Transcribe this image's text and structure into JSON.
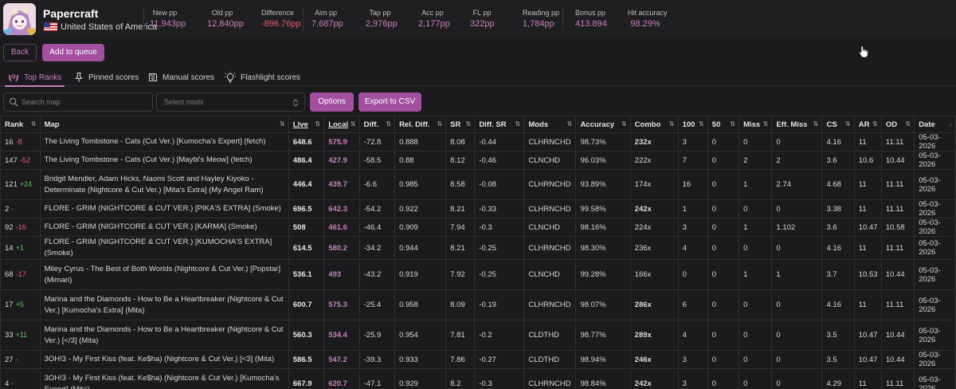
{
  "profile": {
    "username": "Papercraft",
    "country": "United States of America"
  },
  "stats": [
    {
      "label": "New pp",
      "value": "11,943pp"
    },
    {
      "label": "Old pp",
      "value": "12,840pp"
    },
    {
      "label": "Difference",
      "value": "-896.76pp"
    },
    {
      "label": "Aim pp",
      "value": "7,687pp"
    },
    {
      "label": "Tap pp",
      "value": "2,976pp"
    },
    {
      "label": "Acc pp",
      "value": "2,177pp"
    },
    {
      "label": "FL pp",
      "value": "322pp"
    },
    {
      "label": "Reading pp",
      "value": "1,784pp"
    },
    {
      "label": "Bonus pp",
      "value": "413.894"
    },
    {
      "label": "Hit accuracy",
      "value": "98.29%"
    }
  ],
  "colors": {
    "accent": "#a24fa0",
    "accent_text": "#c87fbf",
    "negative": "#e06070",
    "positive": "#5fc25f",
    "combo_highlight": "#8fe04a"
  },
  "actions": {
    "back": "Back",
    "add_to_queue": "Add to queue",
    "options": "Options",
    "export": "Export to CSV"
  },
  "tabs": [
    {
      "label": "Top Ranks",
      "icon": "laurel-icon",
      "active": true
    },
    {
      "label": "Pinned scores",
      "icon": "pin-icon",
      "active": false
    },
    {
      "label": "Manual scores",
      "icon": "save-icon",
      "active": false
    },
    {
      "label": "Flashlight scores",
      "icon": "lightbulb-icon",
      "active": false
    }
  ],
  "filters": {
    "search_placeholder": "Search map",
    "mods_placeholder": "Select mods"
  },
  "table": {
    "columns": [
      "Rank",
      "Map",
      "Live",
      "Local",
      "Diff.",
      "Rel. Diff.",
      "SR",
      "Diff. SR",
      "Mods",
      "Accuracy",
      "Combo",
      "100",
      "50",
      "Miss",
      "Eff. Miss",
      "CS",
      "AR",
      "OD",
      "Date"
    ],
    "rows": [
      {
        "rank": "16",
        "rank_delta": "-8",
        "map": "The Living Tombstone - Cats (Cut Ver.) [Kumocha's Expert] (fetch)",
        "live": "648.6",
        "local": "575.9",
        "diff": "-72.8",
        "rel_diff": "0.888",
        "sr": "8.08",
        "diff_sr": "-0.44",
        "mods": "CLHRNCHD",
        "accuracy": "98.73%",
        "combo": "232x",
        "c100": "3",
        "c50": "0",
        "miss": "0",
        "eff_miss": "0",
        "cs": "4.16",
        "ar": "11",
        "od": "11.11",
        "date": "05-03-2026"
      },
      {
        "rank": "147",
        "rank_delta": "-52",
        "map": "The Living Tombstone - Cats (Cut Ver.) [Maybl's Meow] (fetch)",
        "live": "486.4",
        "local": "427.9",
        "diff": "-58.5",
        "rel_diff": "0.88",
        "sr": "8.12",
        "diff_sr": "-0.46",
        "mods": "CLNCHD",
        "accuracy": "96.03%",
        "combo": "222x",
        "c100": "7",
        "c50": "0",
        "miss": "2",
        "eff_miss": "2",
        "cs": "3.6",
        "ar": "10.6",
        "od": "10.44",
        "date": "05-03-2026"
      },
      {
        "rank": "121",
        "rank_delta": "+24",
        "map": "Bridgit Mendler, Adam Hicks, Naomi Scott and Hayley Kiyoko - Determinate (Nightcore & Cut Ver.) [Mita's Extra] (My Angel Ram)",
        "live": "446.4",
        "local": "439.7",
        "diff": "-6.6",
        "rel_diff": "0.985",
        "sr": "8.58",
        "diff_sr": "-0.08",
        "mods": "CLHRNCHD",
        "accuracy": "93.89%",
        "combo": "174x",
        "c100": "16",
        "c50": "0",
        "miss": "1",
        "eff_miss": "2.74",
        "cs": "4.68",
        "ar": "11",
        "od": "11.11",
        "date": "05-03-2026"
      },
      {
        "rank": "2",
        "rank_delta": "-",
        "map": "FLORE - GRIM (NIGHTCORE & CUT VER.) [PIKA'S EXTRA] (Smoke)",
        "live": "696.5",
        "local": "642.3",
        "diff": "-54.2",
        "rel_diff": "0.922",
        "sr": "8.21",
        "diff_sr": "-0.33",
        "mods": "CLHRNCHD",
        "accuracy": "99.58%",
        "combo": "242x",
        "c100": "1",
        "c50": "0",
        "miss": "0",
        "eff_miss": "0",
        "cs": "3.38",
        "ar": "11",
        "od": "11.11",
        "date": "05-03-2026"
      },
      {
        "rank": "92",
        "rank_delta": "-16",
        "map": "FLORE - GRIM (NIGHTCORE & CUT VER.) [KARMA] (Smoke)",
        "live": "508",
        "local": "461.6",
        "diff": "-46.4",
        "rel_diff": "0.909",
        "sr": "7.94",
        "diff_sr": "-0.3",
        "mods": "CLNCHD",
        "accuracy": "98.16%",
        "combo": "224x",
        "c100": "3",
        "c50": "0",
        "miss": "1",
        "eff_miss": "1.102",
        "cs": "3.6",
        "ar": "10.47",
        "od": "10.58",
        "date": "05-03-2026"
      },
      {
        "rank": "14",
        "rank_delta": "+1",
        "map": "FLORE - GRIM (NIGHTCORE & CUT VER.) [KUMOCHA'S EXTRA] (Smoke)",
        "live": "614.5",
        "local": "580.2",
        "diff": "-34.2",
        "rel_diff": "0.944",
        "sr": "8.21",
        "diff_sr": "-0.25",
        "mods": "CLHRNCHD",
        "accuracy": "98.30%",
        "combo": "236x",
        "c100": "4",
        "c50": "0",
        "miss": "0",
        "eff_miss": "0",
        "cs": "4.16",
        "ar": "11",
        "od": "11.11",
        "date": "05-03-2026"
      },
      {
        "rank": "68",
        "rank_delta": "-17",
        "map": "Miley Cyrus - The Best of Both Worlds (Nightcore & Cut Ver.) [Popstar] (Mimari)",
        "live": "536.1",
        "local": "493",
        "diff": "-43.2",
        "rel_diff": "0.919",
        "sr": "7.92",
        "diff_sr": "-0.25",
        "mods": "CLNCHD",
        "accuracy": "99.28%",
        "combo": "166x",
        "c100": "0",
        "c50": "0",
        "miss": "1",
        "eff_miss": "1",
        "cs": "3.7",
        "ar": "10.53",
        "od": "10.44",
        "date": "05-03-2026"
      },
      {
        "rank": "17",
        "rank_delta": "+5",
        "map": "Marina and the Diamonds - How to Be a Heartbreaker (Nightcore & Cut Ver.) [Kumocha's Extra] (Mita)",
        "live": "600.7",
        "local": "575.3",
        "diff": "-25.4",
        "rel_diff": "0.958",
        "sr": "8.09",
        "diff_sr": "-0.19",
        "mods": "CLHRNCHD",
        "accuracy": "98.07%",
        "combo": "286x",
        "c100": "6",
        "c50": "0",
        "miss": "0",
        "eff_miss": "0",
        "cs": "4.16",
        "ar": "11",
        "od": "11.11",
        "date": "05-03-2026"
      },
      {
        "rank": "33",
        "rank_delta": "+11",
        "map": "Marina and the Diamonds - How to Be a Heartbreaker (Nightcore & Cut Ver.) [</3] (Mita)",
        "live": "560.3",
        "local": "534.4",
        "diff": "-25.9",
        "rel_diff": "0.954",
        "sr": "7.81",
        "diff_sr": "-0.2",
        "mods": "CLDTHD",
        "accuracy": "98.77%",
        "combo": "289x",
        "c100": "4",
        "c50": "0",
        "miss": "0",
        "eff_miss": "0",
        "cs": "3.5",
        "ar": "10.47",
        "od": "10.44",
        "date": "05-03-2026"
      },
      {
        "rank": "27",
        "rank_delta": "-",
        "map": "3OH!3 - My First Kiss (feat. Ke$ha) (Nightcore & Cut Ver.) [<3] (Mita)",
        "live": "586.5",
        "local": "547.2",
        "diff": "-39.3",
        "rel_diff": "0.933",
        "sr": "7.86",
        "diff_sr": "-0.27",
        "mods": "CLDTHD",
        "accuracy": "98.94%",
        "combo": "246x",
        "c100": "3",
        "c50": "0",
        "miss": "0",
        "eff_miss": "0",
        "cs": "3.5",
        "ar": "10.47",
        "od": "10.44",
        "date": "05-03-2026"
      },
      {
        "rank": "4",
        "rank_delta": "-",
        "map": "3OH!3 - My First Kiss (feat. Ke$ha) (Nightcore & Cut Ver.) [Kumocha's Expert] (Mita)",
        "live": "667.9",
        "local": "620.7",
        "diff": "-47.1",
        "rel_diff": "0.929",
        "sr": "8.2",
        "diff_sr": "-0.3",
        "mods": "CLHRNCHD",
        "accuracy": "98.84%",
        "combo": "242x",
        "c100": "3",
        "c50": "0",
        "miss": "0",
        "eff_miss": "0",
        "cs": "4.29",
        "ar": "11",
        "od": "11.11",
        "date": "05-03-2026"
      }
    ]
  }
}
